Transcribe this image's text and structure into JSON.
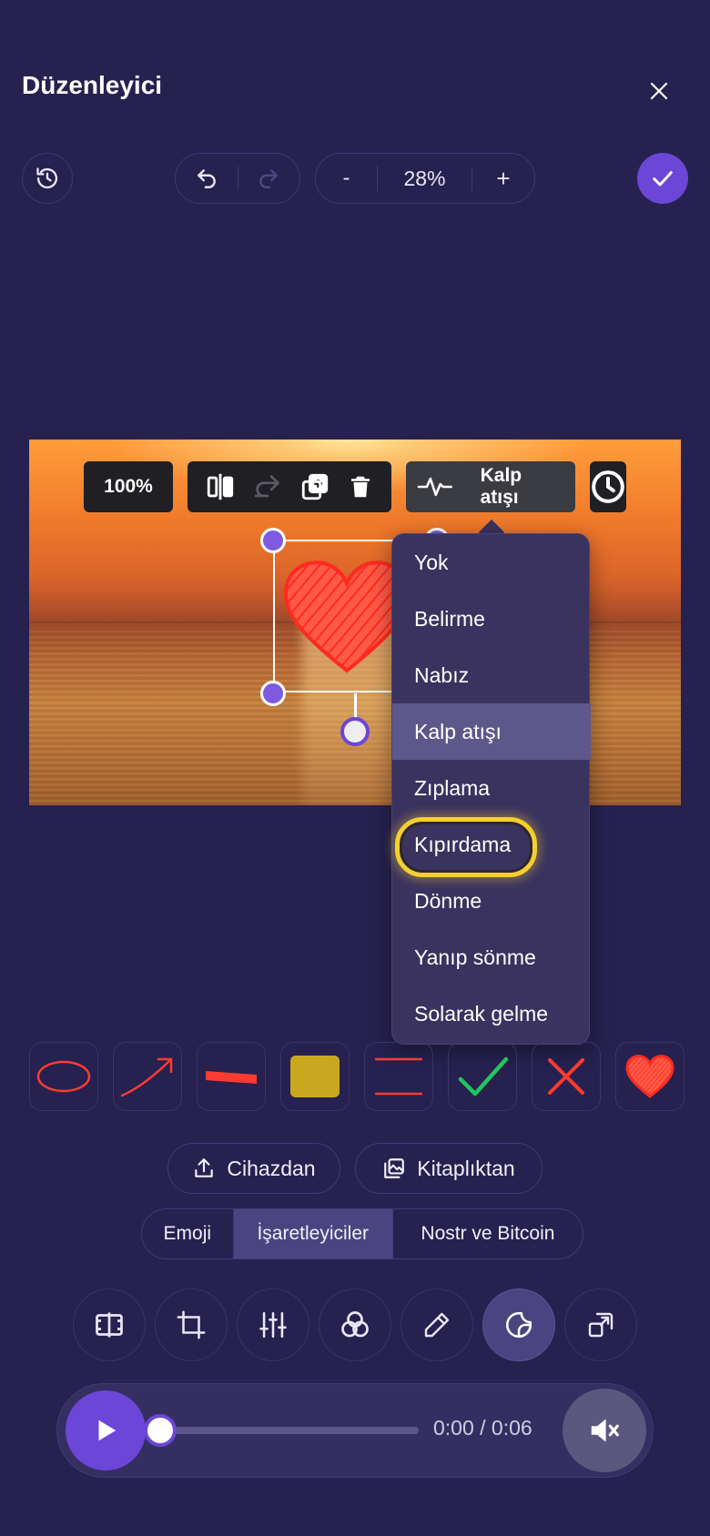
{
  "header": {
    "title": "Düzenleyici"
  },
  "toolbar": {
    "zoom_minus": "-",
    "zoom_value": "28%",
    "zoom_plus": "+"
  },
  "image_toolbar": {
    "scale": "100%",
    "animation_label": "Kalp atışı"
  },
  "animation_menu": {
    "items": [
      "Yok",
      "Belirme",
      "Nabız",
      "Kalp atışı",
      "Zıplama",
      "Kıpırdama",
      "Dönme",
      "Yanıp sönme",
      "Solarak gelme"
    ],
    "selected": "Kalp atışı",
    "highlighted": "Kıpırdama"
  },
  "stickers": [
    "ellipse-marker",
    "arrow-marker",
    "line-marker",
    "highlight-marker",
    "double-line-marker",
    "check-mark",
    "cross-mark",
    "heart-marker"
  ],
  "source": {
    "device_label": "Cihazdan",
    "library_label": "Kitaplıktan"
  },
  "tabs": {
    "items": [
      "Emoji",
      "İşaretleyiciler",
      "Nostr ve Bitcoin"
    ],
    "active": "İşaretleyiciler"
  },
  "modes": [
    "frames-icon",
    "crop-icon",
    "sliders-icon",
    "filters-icon",
    "pencil-icon",
    "sticker-icon",
    "resize-icon"
  ],
  "player": {
    "time": "0:00 / 0:06",
    "progress": 0
  },
  "colors": {
    "background": "#26214f",
    "accent": "#6c46d6",
    "highlight_ring": "#f5cf2d",
    "marker_red": "#ff3b30",
    "check_green": "#22c55e"
  }
}
